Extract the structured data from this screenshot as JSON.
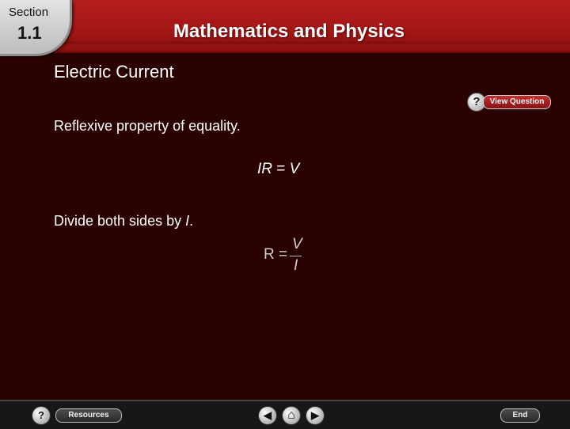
{
  "header": {
    "section_label": "Section",
    "section_number": "1.1",
    "chapter_title": "Mathematics and Physics"
  },
  "slide": {
    "subtitle": "Electric Current",
    "view_question_label": "View Question",
    "line1": "Reflexive property of equality.",
    "equation1": "IR = V",
    "line2": "Divide both sides by I.",
    "equation2": {
      "lhs": "R =",
      "numerator": "V",
      "denominator": "I"
    }
  },
  "footer": {
    "help_icon_glyph": "?",
    "resources_label": "Resources",
    "prev_glyph": "◀",
    "home_glyph": "⌂",
    "next_glyph": "▶",
    "end_label": "End"
  },
  "colors": {
    "background": "#2a0202",
    "header": "#b41d1d",
    "text": "#ffffff"
  }
}
